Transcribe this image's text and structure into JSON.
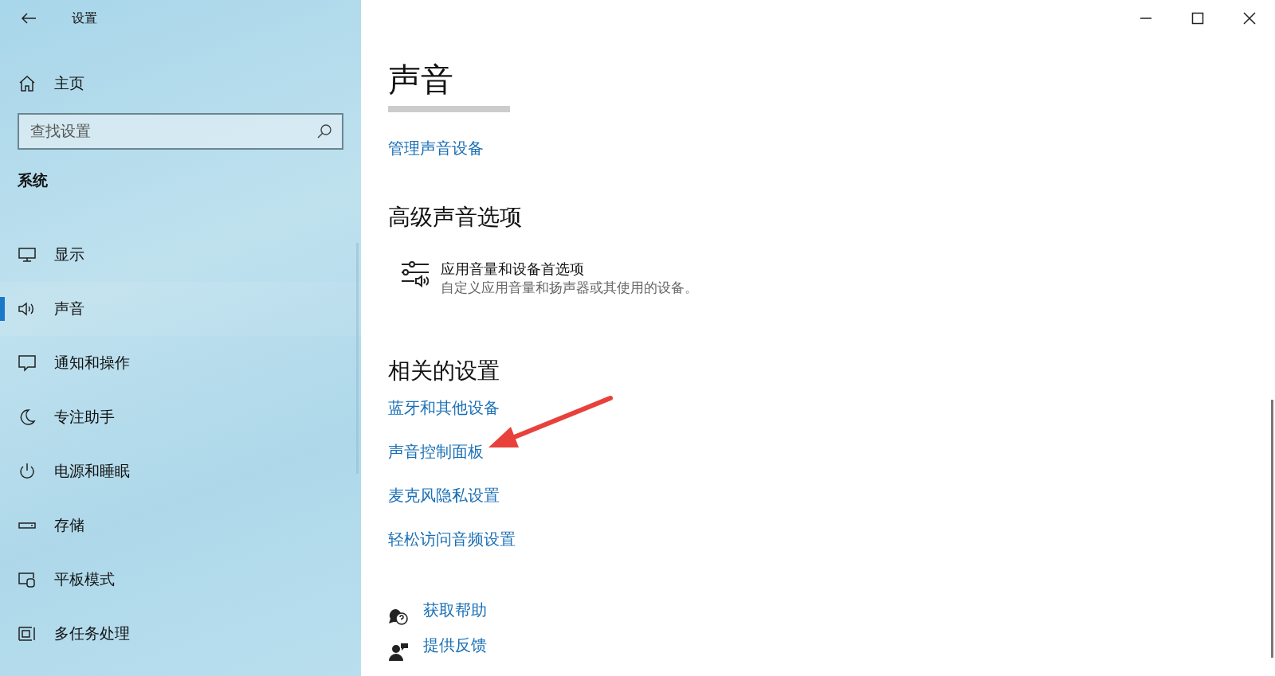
{
  "window": {
    "title": "设置"
  },
  "sidebar": {
    "home": "主页",
    "search": {
      "placeholder": "查找设置"
    },
    "section": "系统",
    "items": [
      {
        "label": "显示",
        "selected": false
      },
      {
        "label": "声音",
        "selected": true
      },
      {
        "label": "通知和操作",
        "selected": false
      },
      {
        "label": "专注助手",
        "selected": false
      },
      {
        "label": "电源和睡眠",
        "selected": false
      },
      {
        "label": "存储",
        "selected": false
      },
      {
        "label": "平板模式",
        "selected": false
      },
      {
        "label": "多任务处理",
        "selected": false
      }
    ]
  },
  "main": {
    "title": "声音",
    "manage_link": "管理声音设备",
    "advanced": {
      "heading": "高级声音选项",
      "option": {
        "title": "应用音量和设备首选项",
        "description": "自定义应用音量和扬声器或其使用的设备。"
      }
    },
    "related": {
      "heading": "相关的设置",
      "links": [
        "蓝牙和其他设备",
        "声音控制面板",
        "麦克风隐私设置",
        "轻松访问音频设置"
      ]
    },
    "help": [
      {
        "label": "获取帮助"
      },
      {
        "label": "提供反馈"
      }
    ]
  }
}
